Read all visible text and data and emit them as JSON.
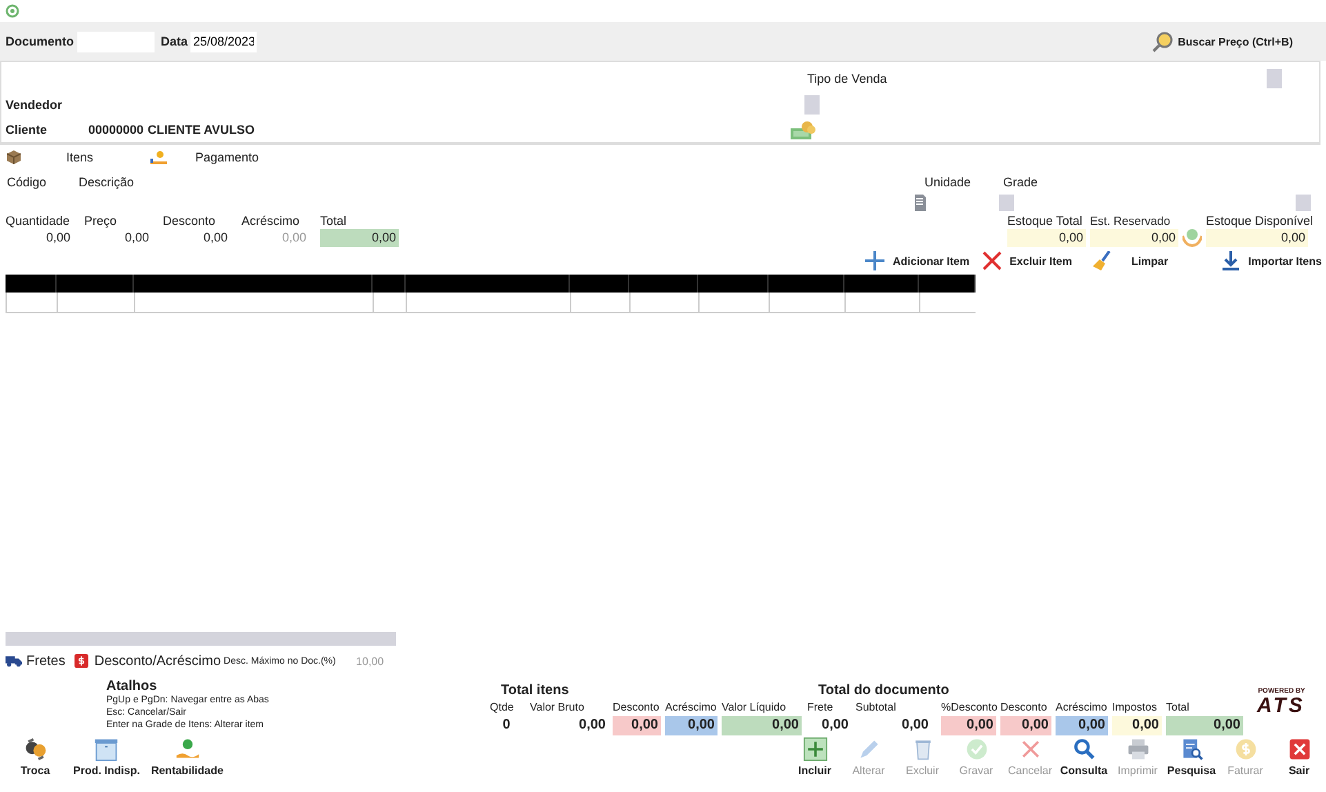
{
  "header": {
    "fields": [
      {
        "label": "Documento"
      },
      {
        "label": "Data",
        "value": "25/08/2023"
      }
    ],
    "price_button": "Buscar Preço (Ctrl+B)"
  },
  "sale_panel": {
    "sale_type_label": "Tipo de Venda",
    "seller_label": "Vendedor",
    "customer_label": "Cliente",
    "customer_code": "00000000",
    "customer_name": "CLIENTE AVULSO"
  },
  "tabs": [
    {
      "label": "Itens",
      "kind": "box"
    },
    {
      "label": "Pagamento",
      "kind": "pay"
    }
  ],
  "item_form": {
    "code_label": "Código",
    "description_label": "Descrição",
    "unit_label": "Unidade",
    "grid_label": "Grade",
    "amounts": [
      {
        "label": "Quantidade",
        "value": "0,00",
        "disabled": false
      },
      {
        "label": "Preço",
        "value": "0,00",
        "disabled": false
      },
      {
        "label": "Desconto",
        "value": "0,00",
        "disabled": false
      },
      {
        "label": "Acréscimo",
        "value": "0,00",
        "disabled": true
      },
      {
        "label": "Total",
        "value": "0,00",
        "disabled": false,
        "color": "#bddcbd"
      }
    ],
    "stock": [
      {
        "label": "Estoque Total",
        "value": "0,00"
      },
      {
        "label": "Est. Reservado",
        "value": "0,00"
      },
      {
        "label": "Estoque Disponível",
        "value": "0,00"
      }
    ]
  },
  "actions": [
    {
      "label": "Adicionar Item",
      "kind": "add"
    },
    {
      "label": "Excluir Item",
      "kind": "delete"
    },
    {
      "label": "Limpar",
      "kind": "clear"
    },
    {
      "label": "Importar Itens",
      "kind": "import"
    }
  ],
  "footer_links": [
    {
      "label": "Fretes",
      "kind": "truck"
    },
    {
      "label": "Desconto/Acréscimo",
      "kind": "discount"
    }
  ],
  "max_discount": {
    "label": "Desc. Máximo no Doc.(%)",
    "value": "10,00",
    "disabled": true
  },
  "shortcuts": {
    "title": "Atalhos",
    "lines": [
      "PgUp e PgDn: Navegar entre as Abas",
      "Esc: Cancelar/Sair",
      "Enter na Grade de Itens: Alterar item"
    ]
  },
  "item_totals": {
    "title": "Total itens",
    "fields": [
      {
        "label": "Qtde",
        "value": "0"
      },
      {
        "label": "Valor Bruto",
        "value": "0,00"
      },
      {
        "label": "Desconto",
        "value": "0,00",
        "color": "#f7c9c9"
      },
      {
        "label": "Acréscimo",
        "value": "0,00",
        "color": "#a9c7ea"
      },
      {
        "label": "Valor Líquido",
        "value": "0,00",
        "color": "#bddcbd"
      }
    ]
  },
  "document_totals": {
    "title": "Total do documento",
    "fields": [
      {
        "label": "Frete",
        "value": "0,00"
      },
      {
        "label": "Subtotal",
        "value": "0,00"
      },
      {
        "label": "%Desconto",
        "value": "0,00",
        "color": "#f7c9c9"
      },
      {
        "label": "Desconto",
        "value": "0,00",
        "color": "#f7c9c9"
      },
      {
        "label": "Acréscimo",
        "value": "0,00",
        "color": "#a9c7ea"
      },
      {
        "label": "Impostos",
        "value": "0,00",
        "color": "#fdf9dc"
      },
      {
        "label": "Total",
        "value": "0,00",
        "color": "#bddcbd"
      }
    ]
  },
  "logo": {
    "tagline": "POWERED BY",
    "name": "ATS"
  },
  "left_tools": [
    {
      "label": "Troca",
      "kind": "exchange"
    },
    {
      "label": "Prod. Indisp.",
      "kind": "box"
    },
    {
      "label": "Rentabilidade",
      "kind": "profit"
    }
  ],
  "toolbar": [
    {
      "label": "Incluir",
      "kind": "add",
      "disabled": false
    },
    {
      "label": "Alterar",
      "kind": "edit",
      "disabled": true
    },
    {
      "label": "Excluir",
      "kind": "trash",
      "disabled": true
    },
    {
      "label": "Gravar",
      "kind": "check",
      "disabled": true
    },
    {
      "label": "Cancelar",
      "kind": "cancel",
      "disabled": true
    },
    {
      "label": "Consulta",
      "kind": "search",
      "disabled": false
    },
    {
      "label": "Imprimir",
      "kind": "print",
      "disabled": true
    },
    {
      "label": "Pesquisa",
      "kind": "report",
      "disabled": false
    },
    {
      "label": "Faturar",
      "kind": "coin",
      "disabled": true
    },
    {
      "label": "Sair",
      "kind": "exit",
      "disabled": false
    }
  ]
}
